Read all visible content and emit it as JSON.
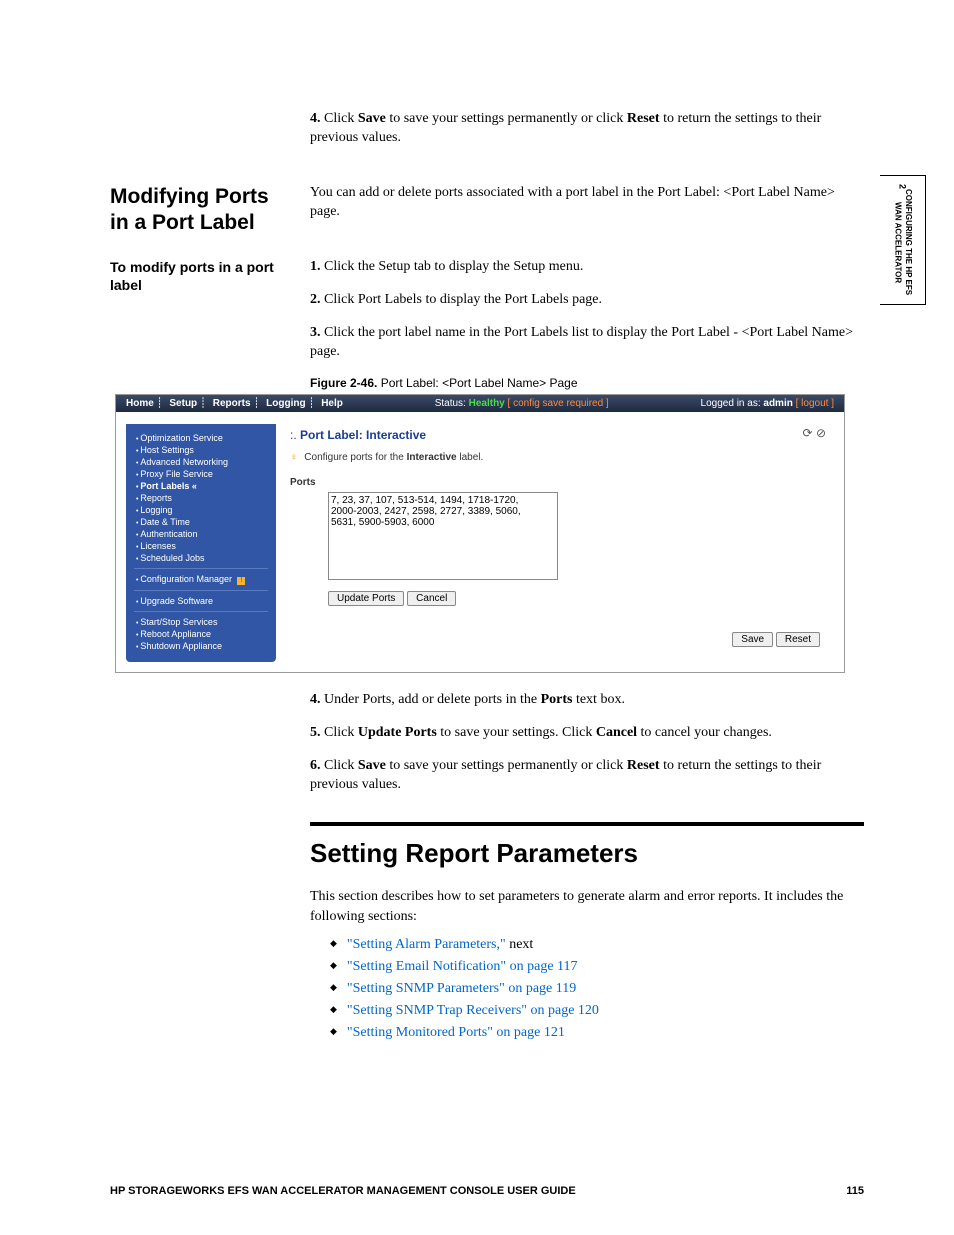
{
  "side_tab": {
    "num": "2",
    "line1": "CONFIGURING THE HP EFS",
    "line2": "WAN ACCELERATOR"
  },
  "intro_step": {
    "num": "4.",
    "text_a": "Click ",
    "save": "Save",
    "text_b": " to save your settings permanently or click ",
    "reset": "Reset",
    "text_c": " to return the settings to their previous values."
  },
  "sec1": {
    "heading": "Modifying Ports in a Port Label",
    "body": "You can add or delete ports associated with a port label in the Port Label: <Port Label Name> page."
  },
  "proc": {
    "heading": "To modify ports in a port label",
    "steps": [
      {
        "num": "1.",
        "text": "Click the Setup tab to display the Setup menu."
      },
      {
        "num": "2.",
        "text": "Click Port Labels to display the Port Labels page."
      },
      {
        "num": "3.",
        "text": "Click the port label name in the Port Labels list to display the Port Label - <Port Label Name> page."
      }
    ]
  },
  "figure": {
    "label": "Figure 2-46.",
    "caption": "Port Label: <Port Label Name> Page"
  },
  "screenshot": {
    "nav": [
      "Home",
      "Setup",
      "Reports",
      "Logging",
      "Help"
    ],
    "status_label": "Status:",
    "status_value": "Healthy",
    "status_note": "[ config save required ]",
    "login_prefix": "Logged in as:",
    "login_user": "admin",
    "logout": "[ logout ]",
    "sidebar_groups": [
      [
        "Optimization Service",
        "Host Settings",
        "Advanced Networking",
        "Proxy File Service",
        "Port Labels «",
        "Reports",
        "Logging",
        "Date & Time",
        "Authentication",
        "Licenses",
        "Scheduled Jobs"
      ],
      [
        "Configuration Manager"
      ],
      [
        "Upgrade Software"
      ],
      [
        "Start/Stop Services",
        "Reboot Appliance",
        "Shutdown Appliance"
      ]
    ],
    "title_prefix": ":. ",
    "title_label": "Port Label: ",
    "title_value": "Interactive",
    "hint_a": "Configure ports for the ",
    "hint_b": "Interactive",
    "hint_c": " label.",
    "ports_label": "Ports",
    "ports_value": "7, 23, 37, 107, 513-514, 1494, 1718-1720, 2000-2003, 2427, 2598, 2727, 3389, 5060, 5631, 5900-5903, 6000",
    "btn_update": "Update Ports",
    "btn_cancel": "Cancel",
    "btn_save": "Save",
    "btn_reset": "Reset"
  },
  "post_steps": {
    "s4": {
      "num": "4.",
      "a": "Under Ports, add or delete ports in the ",
      "b": "Ports",
      "c": " text box."
    },
    "s5": {
      "num": "5.",
      "a": "Click ",
      "b": "Update Ports",
      "c": " to save your settings. Click ",
      "d": "Cancel",
      "e": " to cancel your changes."
    },
    "s6": {
      "num": "6.",
      "a": "Click ",
      "b": "Save",
      "c": " to save your settings permanently or click ",
      "d": "Reset",
      "e": " to return the settings to their previous values."
    }
  },
  "sec2": {
    "heading": "Setting Report Parameters",
    "intro": "This section describes how to set parameters to generate alarm and error reports. It includes the following sections:",
    "links": [
      {
        "text": "\"Setting Alarm Parameters,\"",
        "suffix": " next"
      },
      {
        "text": "\"Setting Email Notification\" on page 117",
        "suffix": ""
      },
      {
        "text": "\"Setting SNMP Parameters\" on page 119",
        "suffix": ""
      },
      {
        "text": "\"Setting SNMP Trap Receivers\" on page 120",
        "suffix": ""
      },
      {
        "text": "\"Setting Monitored Ports\" on page 121",
        "suffix": ""
      }
    ]
  },
  "footer": {
    "title": "HP STORAGEWORKS EFS WAN ACCELERATOR MANAGEMENT CONSOLE USER GUIDE",
    "page": "115"
  }
}
